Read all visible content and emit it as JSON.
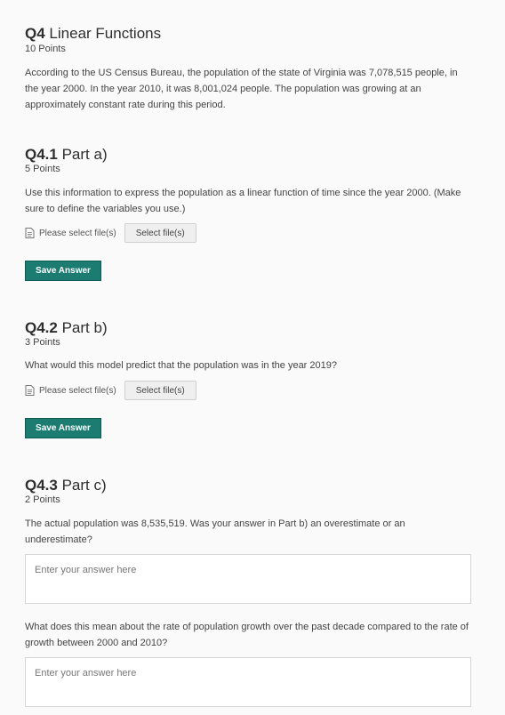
{
  "q4": {
    "number": "Q4",
    "title": "Linear Functions",
    "points": "10 Points",
    "intro": "According to the US Census Bureau, the population of the state of Virginia was 7,078,515 people, in the year 2000.  In the year 2010, it was 8,001,024 people.  The population was growing at an approximately constant rate during this period."
  },
  "q41": {
    "number": "Q4.1",
    "title": "Part a)",
    "points": "5 Points",
    "prompt": "Use this information to express the population as a linear function of time since the year 2000. (Make sure to define the variables you use.)",
    "file_label": "Please select file(s)",
    "select_label": "Select file(s)",
    "save_label": "Save Answer"
  },
  "q42": {
    "number": "Q4.2",
    "title": "Part b)",
    "points": "3 Points",
    "prompt": "What would this model predict that the population was in the year 2019?",
    "file_label": "Please select file(s)",
    "select_label": "Select file(s)",
    "save_label": "Save Answer"
  },
  "q43": {
    "number": "Q4.3",
    "title": "Part c)",
    "points": "2 Points",
    "prompt1": "The actual population was 8,535,519. Was your answer in Part b) an overestimate or an underestimate?",
    "placeholder1": "Enter your answer here",
    "prompt2": "What does this mean about the rate of population growth over the past decade compared to the rate of growth between 2000 and 2010?",
    "placeholder2": "Enter your answer here"
  },
  "colors": {
    "accent": "#1c7c72",
    "background": "#fafafa"
  },
  "icons": {
    "file": "file-document-icon"
  }
}
